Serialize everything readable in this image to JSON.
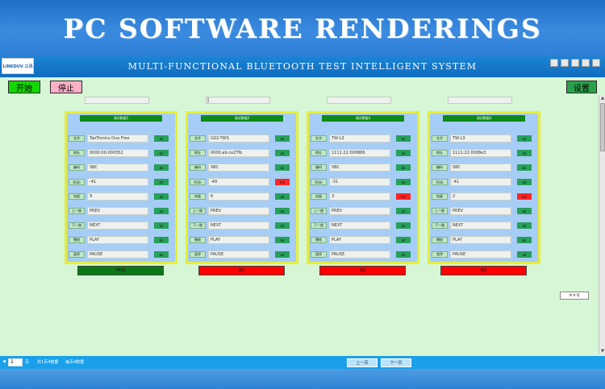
{
  "banner": {
    "title": "PC SOFTWARE RENDERINGS"
  },
  "app": {
    "logo_text": "LINKDUV 三讯",
    "system_title": "MULTI-FUNCTIONAL BLUETOOTH TEST INTELLIGENT SYSTEM",
    "buttons": {
      "start": "开始",
      "stop": "停止",
      "settings": "设置"
    },
    "search_boxes": [
      "",
      "|",
      "",
      ""
    ]
  },
  "panels": [
    {
      "header": "测试数据1",
      "rows": [
        {
          "label": "名字",
          "value": "TaoTronics Duo Free",
          "status": "ok"
        },
        {
          "label": "地址",
          "value": "0000:00:000352",
          "status": "ok"
        },
        {
          "label": "编码",
          "value": "SBC",
          "status": "ok"
        },
        {
          "label": "RSSI",
          "value": "-41",
          "status": "ok"
        },
        {
          "label": "电量",
          "value": "9",
          "status": "ok"
        },
        {
          "label": "上一曲",
          "value": "PREV",
          "status": "ok"
        },
        {
          "label": "下一曲",
          "value": "NEXT",
          "status": "ok"
        },
        {
          "label": "播放",
          "value": "PLAY",
          "status": "ok"
        },
        {
          "label": "暂停",
          "value": "PAUSE",
          "status": "ok"
        }
      ],
      "result": "PASS",
      "result_state": "pass"
    },
    {
      "header": "测试数据2",
      "rows": [
        {
          "label": "名字",
          "value": "G02-TWS",
          "status": "ok"
        },
        {
          "label": "地址",
          "value": "0000:ab:ce2Tfb",
          "status": "ok"
        },
        {
          "label": "编码",
          "value": "SBC",
          "status": "ok"
        },
        {
          "label": "RSSI",
          "value": "-49",
          "status": "fail"
        },
        {
          "label": "电量",
          "value": "6",
          "status": "ok"
        },
        {
          "label": "上一曲",
          "value": "PREV",
          "status": "ok"
        },
        {
          "label": "下一曲",
          "value": "NEXT",
          "status": "ok"
        },
        {
          "label": "播放",
          "value": "PLAY",
          "status": "ok"
        },
        {
          "label": "暂停",
          "value": "PAUSE",
          "status": "ok"
        }
      ],
      "result": "NG",
      "result_state": "ng"
    },
    {
      "header": "测试数据3",
      "rows": [
        {
          "label": "名字",
          "value": "TW-L3",
          "status": "ok"
        },
        {
          "label": "地址",
          "value": "1111:22:000886",
          "status": "ok"
        },
        {
          "label": "编码",
          "value": "SBC",
          "status": "ok"
        },
        {
          "label": "RSSI",
          "value": "-31",
          "status": "ok"
        },
        {
          "label": "电量",
          "value": "3",
          "status": "fail"
        },
        {
          "label": "上一曲",
          "value": "PREV",
          "status": "ok"
        },
        {
          "label": "下一曲",
          "value": "NEXT",
          "status": "ok"
        },
        {
          "label": "播放",
          "value": "PLAY",
          "status": "ok"
        },
        {
          "label": "暂停",
          "value": "PAUSE",
          "status": "ok"
        }
      ],
      "result": "NG",
      "result_state": "ng"
    },
    {
      "header": "测试数据4",
      "rows": [
        {
          "label": "名字",
          "value": "TW-L3",
          "status": "ok"
        },
        {
          "label": "地址",
          "value": "1111:22:0008e3",
          "status": "ok"
        },
        {
          "label": "编码",
          "value": "SBC",
          "status": "ok"
        },
        {
          "label": "RSSI",
          "value": "-41",
          "status": "ok"
        },
        {
          "label": "电量",
          "value": "2",
          "status": "fail"
        },
        {
          "label": "上一曲",
          "value": "PREV",
          "status": "ok"
        },
        {
          "label": "下一曲",
          "value": "NEXT",
          "status": "ok"
        },
        {
          "label": "播放",
          "value": "PLAY",
          "status": "ok"
        },
        {
          "label": "暂停",
          "value": "PAUSE",
          "status": "ok"
        }
      ],
      "result": "NG",
      "result_state": "ng"
    }
  ],
  "side_box": "中 A 号",
  "bottom": {
    "page_value": "1",
    "page_unit": "页",
    "count_1": "共1页4数据",
    "count_2": "每页4数据",
    "prev": "上一页",
    "next": "下一页"
  },
  "colors": {
    "pass": "#0b7a16",
    "fail": "#ff0000",
    "ok": "#27a05a"
  }
}
